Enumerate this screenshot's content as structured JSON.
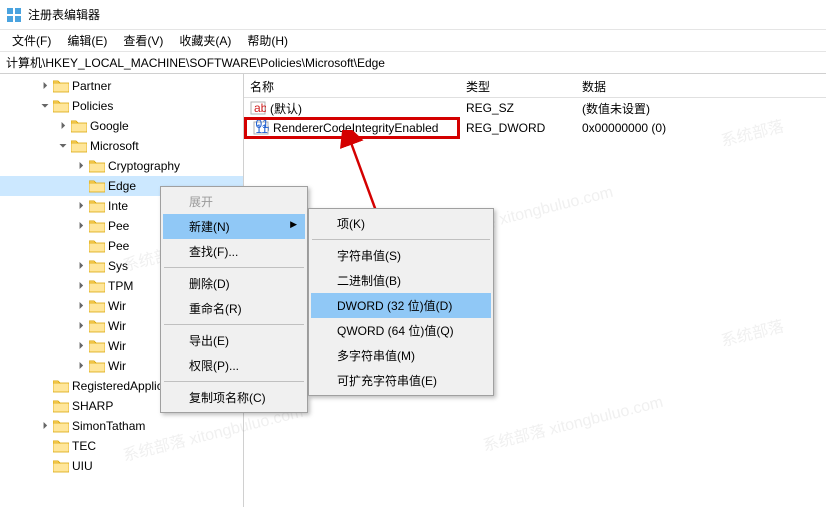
{
  "window": {
    "title": "注册表编辑器"
  },
  "menu": {
    "file": "文件(F)",
    "edit": "编辑(E)",
    "view": "查看(V)",
    "fav": "收藏夹(A)",
    "help": "帮助(H)"
  },
  "address": "计算机\\HKEY_LOCAL_MACHINE\\SOFTWARE\\Policies\\Microsoft\\Edge",
  "columns": {
    "name": "名称",
    "type": "类型",
    "data": "数据"
  },
  "values": [
    {
      "name": "(默认)",
      "type": "REG_SZ",
      "data": "(数值未设置)",
      "kind": "sz"
    },
    {
      "name": "RendererCodeIntegrityEnabled",
      "type": "REG_DWORD",
      "data": "0x00000000 (0)",
      "kind": "dw",
      "highlight": true
    }
  ],
  "tree": {
    "partner": "Partner",
    "policies": "Policies",
    "google": "Google",
    "microsoft": "Microsoft",
    "cryptography": "Cryptography",
    "edge": "Edge",
    "inte": "Inte",
    "pee1": "Pee",
    "pee2": "Pee",
    "sys": "Sys",
    "tpm": "TPM",
    "win1": "Wir",
    "win2": "Wir",
    "win3": "Wir",
    "win4": "Wir",
    "regapps": "RegisteredApplication",
    "sharp": "SHARP",
    "simon": "SimonTatham",
    "tec": "TEC",
    "uiu": "UIU"
  },
  "ctx1": {
    "expand": "展开",
    "new": "新建(N)",
    "find": "查找(F)...",
    "delete": "删除(D)",
    "rename": "重命名(R)",
    "export": "导出(E)",
    "perm": "权限(P)...",
    "copyname": "复制项名称(C)"
  },
  "ctx2": {
    "key": "项(K)",
    "sz": "字符串值(S)",
    "bin": "二进制值(B)",
    "dword": "DWORD (32 位)值(D)",
    "qword": "QWORD (64 位)值(Q)",
    "multi": "多字符串值(M)",
    "expand": "可扩充字符串值(E)"
  }
}
